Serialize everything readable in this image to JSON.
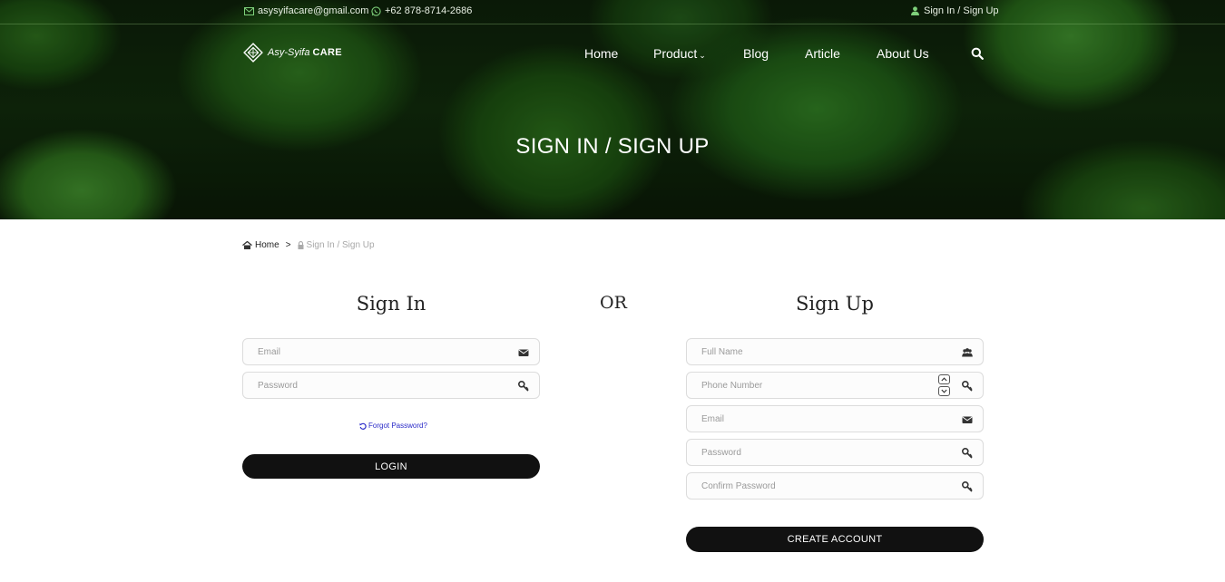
{
  "topbar": {
    "email": "asysyifacare@gmail.com",
    "phone": "+62 878-8714-2686",
    "auth_link": "Sign In / Sign Up"
  },
  "brand": {
    "name": "Asy-Syifa",
    "suffix": "CARE"
  },
  "nav": {
    "home": "Home",
    "product": "Product",
    "blog": "Blog",
    "article": "Article",
    "about": "About Us"
  },
  "hero": {
    "title": "SIGN IN / SIGN UP"
  },
  "breadcrumb": {
    "home": "Home",
    "separator": ">",
    "current": "Sign In / Sign Up"
  },
  "signin": {
    "title": "Sign In",
    "email_placeholder": "Email",
    "password_placeholder": "Password",
    "forgot": "Forgot Password?",
    "button": "LOGIN"
  },
  "or_label": "OR",
  "signup": {
    "title": "Sign Up",
    "fullname_placeholder": "Full Name",
    "phone_placeholder": "Phone Number",
    "email_placeholder": "Email",
    "password_placeholder": "Password",
    "confirm_placeholder": "Confirm Password",
    "button": "CREATE ACCOUNT"
  },
  "icons": {
    "topbar_email": "envelope-outline-icon",
    "topbar_phone": "whatsapp-icon",
    "topbar_user": "user-icon",
    "search": "search-icon",
    "breadcrumb_home": "home-icon",
    "breadcrumb_lock": "lock-icon",
    "email_field": "envelope-icon",
    "password_field": "key-icon",
    "fullname_field": "users-icon",
    "forgot": "undo-icon"
  },
  "colors": {
    "accent_green": "#7ed07a",
    "button_bg": "#111111",
    "link_blue": "#2a2ac8"
  }
}
